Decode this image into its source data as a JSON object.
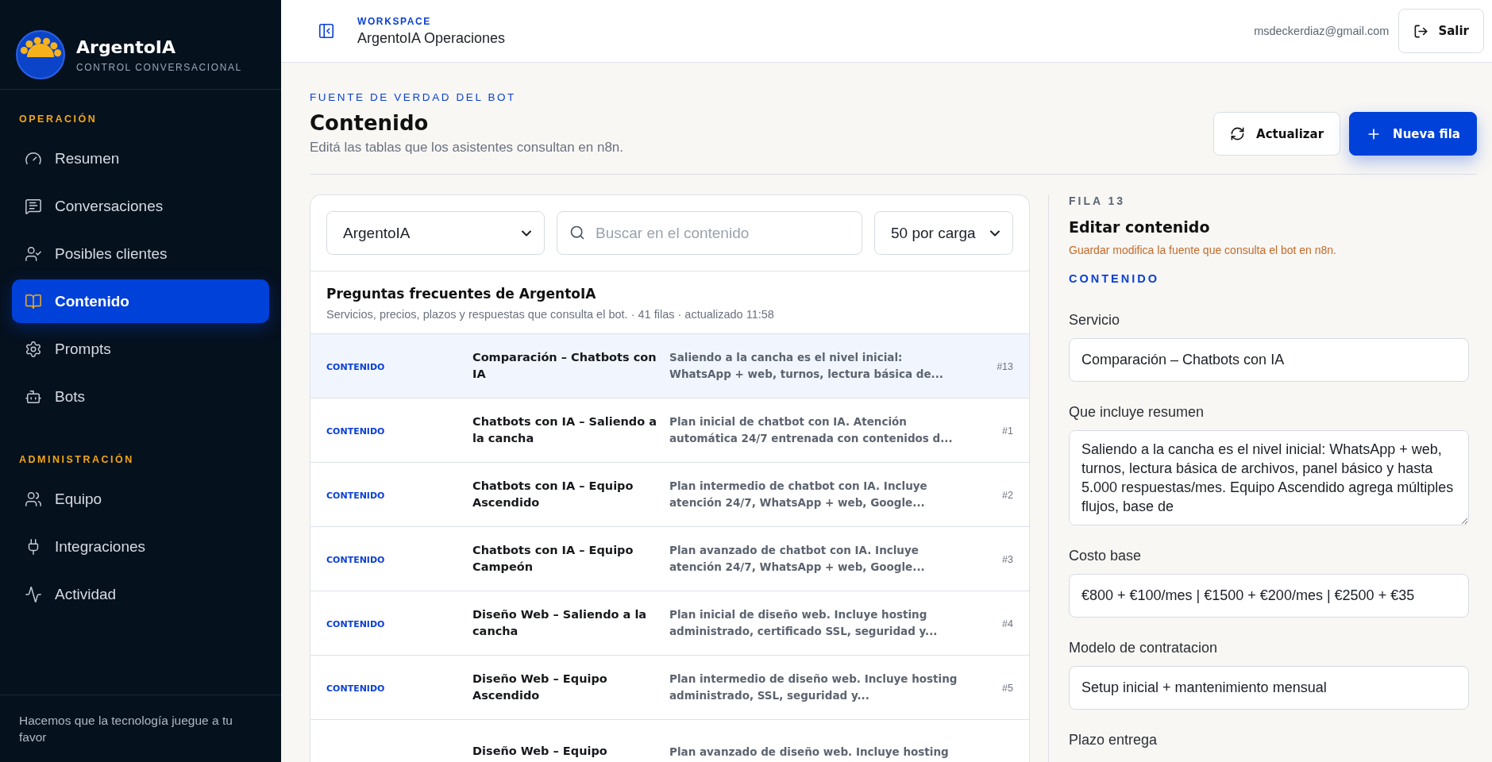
{
  "sidebar": {
    "brand": {
      "name": "ArgentoIA",
      "subtitle": "CONTROL CONVERSACIONAL"
    },
    "sections": [
      {
        "title": "OPERACIÓN",
        "items": [
          {
            "label": "Resumen",
            "selected": false
          },
          {
            "label": "Conversaciones",
            "selected": false
          },
          {
            "label": "Posibles clientes",
            "selected": false
          },
          {
            "label": "Contenido",
            "selected": true
          },
          {
            "label": "Prompts",
            "selected": false
          },
          {
            "label": "Bots",
            "selected": false
          }
        ]
      },
      {
        "title": "ADMINISTRACIÓN",
        "items": [
          {
            "label": "Equipo",
            "selected": false
          },
          {
            "label": "Integraciones",
            "selected": false
          },
          {
            "label": "Actividad",
            "selected": false
          }
        ]
      }
    ],
    "footer": "Hacemos que la tecnología juegue a tu favor"
  },
  "header": {
    "eyebrow": "WORKSPACE",
    "workspace": "ArgentoIA Operaciones",
    "email": "msdeckerdiaz@gmail.com",
    "logout": "Salir"
  },
  "page": {
    "eyebrow": "FUENTE DE VERDAD DEL BOT",
    "title": "Contenido",
    "subtitle": "Editá las tablas que los asistentes consultan en n8n.",
    "actions": [
      {
        "label": "Actualizar",
        "kind": "secondary"
      },
      {
        "label": "Nueva fila",
        "kind": "primary"
      }
    ]
  },
  "filters": {
    "bot": "ArgentoIA",
    "search_placeholder": "Buscar en el contenido",
    "page_size": "50 por carga"
  },
  "table": {
    "title": "Preguntas frecuentes de ArgentoIA",
    "meta": "Servicios, precios, plazos y respuestas que consulta el bot. · 41 filas · actualizado 11:58",
    "rows": [
      {
        "tag": "CONTENIDO",
        "title": "Comparación – Chatbots con IA",
        "summary": "Saliendo a la cancha es el nivel inicial: WhatsApp + web, turnos, lectura básica de...",
        "number": "#13",
        "selected": true
      },
      {
        "tag": "CONTENIDO",
        "title": "Chatbots con IA – Saliendo a la cancha",
        "summary": "Plan inicial de chatbot con IA. Atención automática 24/7 entrenada con contenidos d...",
        "number": "#1",
        "selected": false
      },
      {
        "tag": "CONTENIDO",
        "title": "Chatbots con IA – Equipo Ascendido",
        "summary": "Plan intermedio de chatbot con IA. Incluye atención 24/7, WhatsApp + web, Google...",
        "number": "#2",
        "selected": false
      },
      {
        "tag": "CONTENIDO",
        "title": "Chatbots con IA – Equipo Campeón",
        "summary": "Plan avanzado de chatbot con IA. Incluye atención 24/7, WhatsApp + web, Google...",
        "number": "#3",
        "selected": false
      },
      {
        "tag": "CONTENIDO",
        "title": "Diseño Web – Saliendo a la cancha",
        "summary": "Plan inicial de diseño web. Incluye hosting administrado, certificado SSL, seguridad y...",
        "number": "#4",
        "selected": false
      },
      {
        "tag": "CONTENIDO",
        "title": "Diseño Web – Equipo Ascendido",
        "summary": "Plan intermedio de diseño web. Incluye hosting administrado, SSL, seguridad y...",
        "number": "#5",
        "selected": false
      },
      {
        "title": "Diseño Web – Equipo",
        "summary": "Plan avanzado de diseño web. Incluye hosting",
        "selected": false
      }
    ]
  },
  "editor": {
    "eyebrow": "FILA 13",
    "title": "Editar contenido",
    "note": "Guardar modifica la fuente que consulta el bot en n8n.",
    "section": "CONTENIDO",
    "fields": [
      {
        "label": "Servicio",
        "kind": "input",
        "value": "Comparación – Chatbots con IA"
      },
      {
        "label": "Que incluye resumen",
        "kind": "textarea",
        "value": "Saliendo a la cancha es el nivel inicial: WhatsApp + web, turnos, lectura básica de archivos, panel básico y hasta 5.000 respuestas/mes. Equipo Ascendido agrega múltiples flujos, base de"
      },
      {
        "label": "Costo base",
        "kind": "input",
        "value": "€800 + €100/mes | €1500 + €200/mes | €2500 + €35"
      },
      {
        "label": "Modelo de contratacion",
        "kind": "input",
        "value": "Setup inicial + mantenimiento mensual"
      },
      {
        "label": "Plazo entrega",
        "kind": "label"
      }
    ]
  }
}
